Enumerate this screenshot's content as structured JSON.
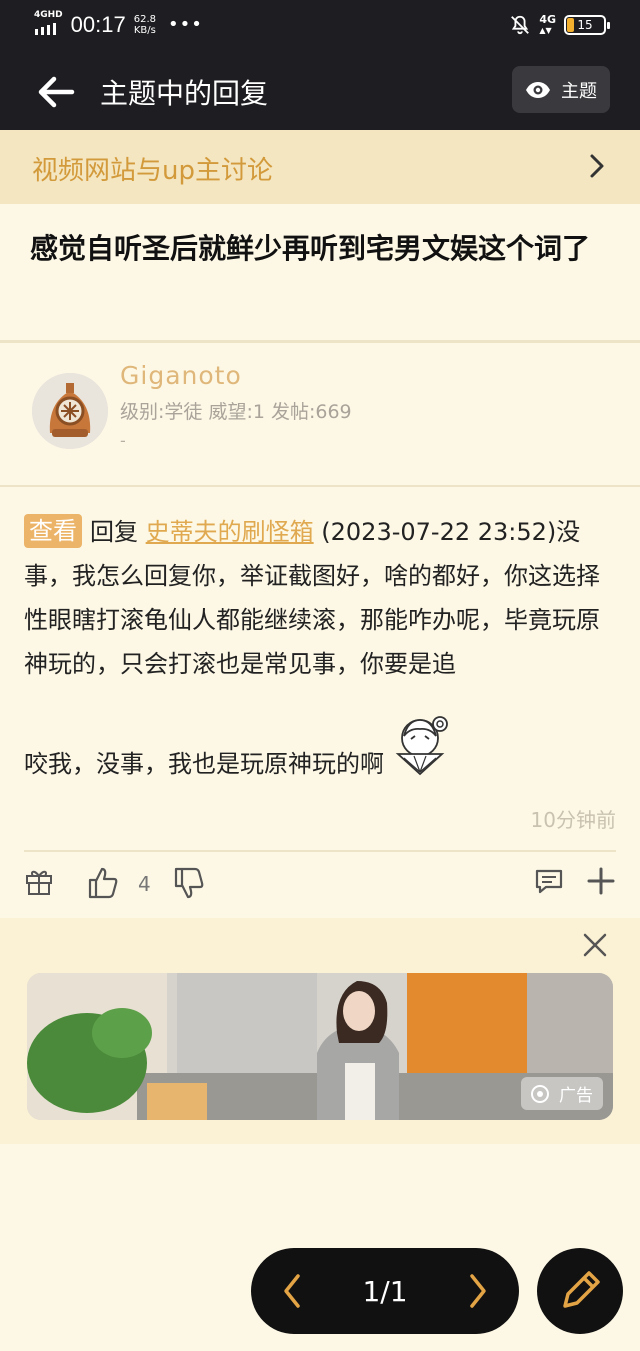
{
  "status_bar": {
    "network_tag": "4GHD",
    "time": "00:17",
    "speed_value": "62.8",
    "speed_unit": "KB/s",
    "more": "•••",
    "signal_right": "4G",
    "battery": "15"
  },
  "app_bar": {
    "title": "主题中的回复",
    "theme_button": "主题"
  },
  "forum": {
    "name": "视频网站与up主讨论"
  },
  "thread": {
    "title": "感觉自听圣后就鲜少再听到宅男文娱这个词了"
  },
  "author": {
    "name": "Giganoto",
    "meta": "级别:学徒 威望:1 发帖:669",
    "signature": "-"
  },
  "post": {
    "view_tag": "查看",
    "reply_word": "回复",
    "reply_user": "史蒂夫的刷怪箱",
    "body_main": "(2023-07-22 23:52)没事，我怎么回复你，举证截图好，啥的都好，你这选择性眼瞎打滚龟仙人都能继续滚，那能咋办呢，毕竟玩原神玩的，只会打滚也是常见事，你要是追",
    "body_last": "咬我，没事，我也是玩原神玩的啊",
    "time_ago": "10分钟前",
    "like_count": "4"
  },
  "ad": {
    "badge": "广告"
  },
  "pager": {
    "page": "1/1"
  },
  "colors": {
    "accent": "#e0a950",
    "bar_dark": "#1e1e22",
    "background": "#fdf8e6"
  }
}
